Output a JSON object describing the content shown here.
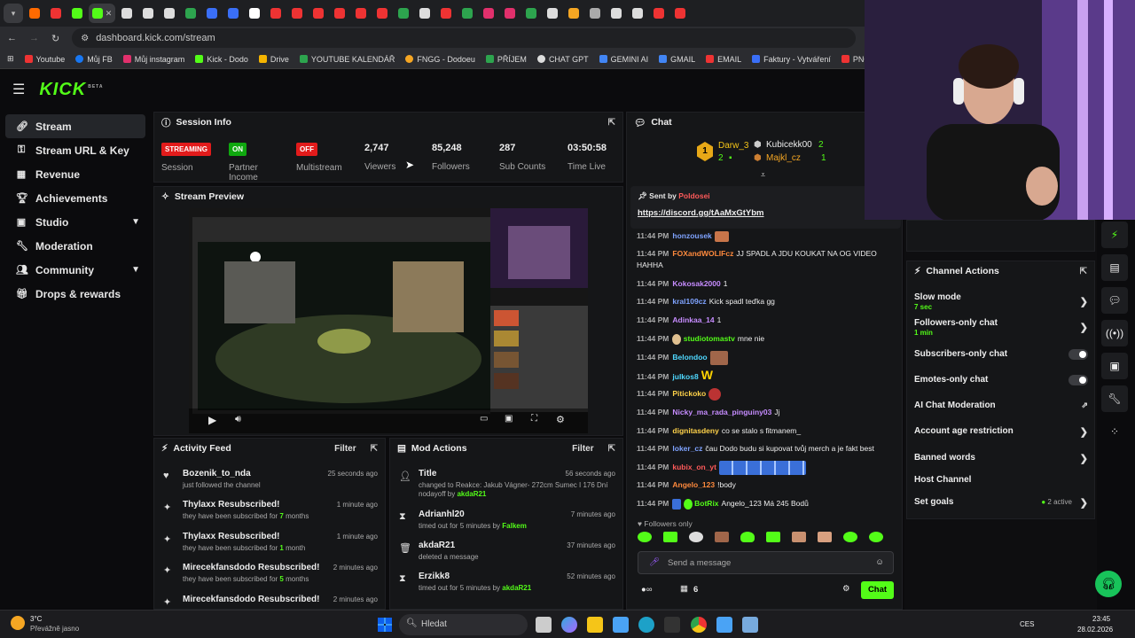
{
  "browser": {
    "url": "dashboard.kick.com/stream",
    "bookmarks": [
      "Youtube",
      "Můj FB",
      "Můj instagram",
      "Kick - Dodo",
      "Drive",
      "YOUTUBE KALENDÁŘ",
      "FNGG - Dodoeu",
      "PŘÍJEM",
      "CHAT GPT",
      "GEMINI AI",
      "GMAIL",
      "EMAIL",
      "Faktury - Vytváření",
      "PNG to PDF"
    ]
  },
  "brand": {
    "logo": "KICK",
    "beta": "BETA",
    "accent": "#53fc18"
  },
  "sidebar": {
    "items": [
      {
        "label": "Stream",
        "icon": "link-icon"
      },
      {
        "label": "Stream URL & Key",
        "icon": "key-icon"
      },
      {
        "label": "Revenue",
        "icon": "revenue-icon"
      },
      {
        "label": "Achievements",
        "icon": "trophy-icon"
      },
      {
        "label": "Studio",
        "icon": "studio-icon"
      },
      {
        "label": "Moderation",
        "icon": "wrench-icon"
      },
      {
        "label": "Community",
        "icon": "people-icon"
      },
      {
        "label": "Drops & rewards",
        "icon": "gift-icon"
      }
    ]
  },
  "session": {
    "title": "Session Info",
    "streaming_badge": "STREAMING",
    "session_label": "Session",
    "partner_badge": "ON",
    "partner_label": "Partner Income",
    "multistream_badge": "OFF",
    "multistream_label": "Multistream",
    "viewers": "2,747",
    "viewers_label": "Viewers",
    "followers": "85,248",
    "followers_label": "Followers",
    "subs": "287",
    "subs_label": "Sub Counts",
    "time": "03:50:58",
    "time_label": "Time Live"
  },
  "preview": {
    "title": "Stream Preview"
  },
  "activity": {
    "title": "Activity Feed",
    "filter": "Filter",
    "items": [
      {
        "name": "Bozenik_to_nda",
        "sub": "just followed the channel",
        "time": "25 seconds ago"
      },
      {
        "name": "Thylaxx Resubscribed!",
        "sub_pre": "they have been subscribed for ",
        "sub_num": "7",
        "sub_post": " months",
        "time": "1 minute ago"
      },
      {
        "name": "Thylaxx Resubscribed!",
        "sub_pre": "they have been subscribed for ",
        "sub_num": "1",
        "sub_post": " month",
        "time": "1 minute ago"
      },
      {
        "name": "Mirecekfansdodo Resubscribed!",
        "sub_pre": "they have been subscribed for ",
        "sub_num": "5",
        "sub_post": " months",
        "time": "2 minutes ago"
      },
      {
        "name": "Mirecekfansdodo Resubscribed!",
        "time": "2 minutes ago"
      }
    ]
  },
  "mod": {
    "title": "Mod Actions",
    "filter": "Filter",
    "items": [
      {
        "name": "Title",
        "line1": "changed to Reakce: Jakub Vágner- 272cm Sumec I 176 Dní nodayoff by",
        "by": "akdaR21",
        "time": "56 seconds ago"
      },
      {
        "name": "Adrianhl20",
        "line1": "timed out for 5 minutes by",
        "by": "Falkem",
        "time": "7 minutes ago"
      },
      {
        "name": "akdaR21",
        "line1": "deleted a message",
        "by": "",
        "time": "37 minutes ago"
      },
      {
        "name": "Erzikk8",
        "line1": "timed out for 5 minutes by",
        "by": "akdaR21",
        "time": "52 minutes ago"
      }
    ]
  },
  "chat": {
    "title": "Chat",
    "podium": {
      "first": "Darw_3",
      "first_count": "2",
      "second": "Kubicekk00",
      "second_count": "2",
      "third": "Majkl_cz",
      "third_count": "1"
    },
    "pinned_label": "Sent by",
    "pinned_user": "Poldosei",
    "pinned_link": "https://discord.gg/tAaMxGtYbm",
    "messages": [
      {
        "time": "11:44 PM",
        "user": "honzousek",
        "color": "#7fa3ff",
        "text": ""
      },
      {
        "time": "11:44 PM",
        "user": "FOXandWOLIFcz",
        "color": "#ff8a3d",
        "text": "JJ SPADL A JDU KOUKAT NA OG VIDEO HAHHA"
      },
      {
        "time": "11:44 PM",
        "user": "Kokosak2000",
        "color": "#c68cff",
        "text": "1"
      },
      {
        "time": "11:44 PM",
        "user": "kral109cz",
        "color": "#7fa3ff",
        "text": "Kick spadl teďka gg"
      },
      {
        "time": "11:44 PM",
        "user": "Adinkaa_14",
        "color": "#c68cff",
        "text": "1"
      },
      {
        "time": "11:44 PM",
        "user": "studiotomastv",
        "color": "#53fc18",
        "text": "mne nie"
      },
      {
        "time": "11:44 PM",
        "user": "Belondoo",
        "color": "#4fd8ff",
        "text": ""
      },
      {
        "time": "11:44 PM",
        "user": "julkos8",
        "color": "#4fd8ff",
        "text": "W"
      },
      {
        "time": "11:44 PM",
        "user": "Pitickoko",
        "color": "#ffd24a",
        "text": ""
      },
      {
        "time": "11:44 PM",
        "user": "Nicky_ma_rada_pinguiny03",
        "color": "#c68cff",
        "text": "Jj"
      },
      {
        "time": "11:44 PM",
        "user": "dignitasdeny",
        "color": "#ffd24a",
        "text": "co se stalo s fitmanem_"
      },
      {
        "time": "11:44 PM",
        "user": "loker_cz",
        "color": "#7fa3ff",
        "text": "čau Dodo budu si kupovat tvůj merch a je fakt best"
      },
      {
        "time": "11:44 PM",
        "user": "kubix_on_yt",
        "color": "#ff5a5a",
        "text": ""
      },
      {
        "time": "11:44 PM",
        "user": "Angelo_123",
        "color": "#ff8a3d",
        "text": "!body"
      },
      {
        "time": "11:44 PM",
        "user": "BotRix",
        "color": "#53fc18",
        "text": "Angelo_123 Má 245 Bodů"
      }
    ],
    "followers_only": "Followers only",
    "placeholder": "Send a message",
    "count": "6",
    "send": "Chat"
  },
  "channel_actions": {
    "title": "Channel Actions",
    "items": [
      {
        "label": "Slow mode",
        "sub": "7 sec",
        "ctrl": "chevron"
      },
      {
        "label": "Followers-only chat",
        "sub": "1 min",
        "ctrl": "chevron"
      },
      {
        "label": "Subscribers-only chat",
        "ctrl": "toggle"
      },
      {
        "label": "Emotes-only chat",
        "ctrl": "toggle"
      },
      {
        "label": "AI Chat Moderation",
        "ctrl": "external"
      },
      {
        "label": "Account age restriction",
        "ctrl": "chevron"
      },
      {
        "label": "Banned words",
        "ctrl": "chevron"
      },
      {
        "label": "Host Channel",
        "ctrl": ""
      },
      {
        "label": "Set goals",
        "extra": "2 active",
        "ctrl": "chevron"
      }
    ]
  },
  "taskbar": {
    "weather_temp": "3°C",
    "weather_desc": "Převážně jasno",
    "search": "Hledat",
    "lang": "CES",
    "time": "23:45",
    "date": "28.02.2026"
  }
}
